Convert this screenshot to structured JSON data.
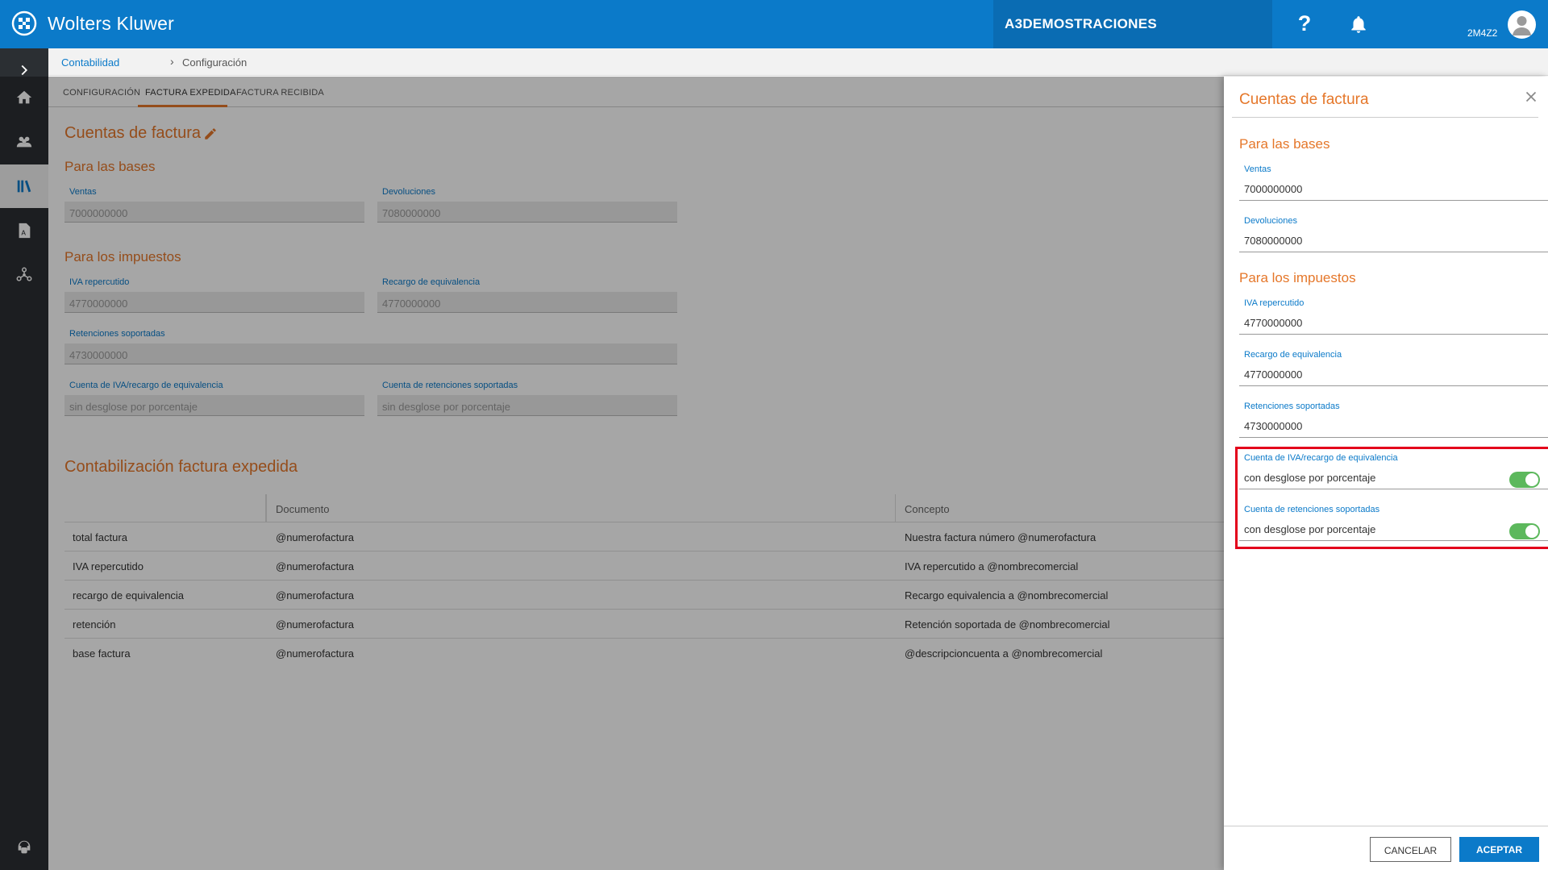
{
  "topbar": {
    "brand": "Wolters Kluwer",
    "organization": "A3DEMOSTRACIONES",
    "help_icon": "?",
    "user": "2M4Z2"
  },
  "breadcrumb": {
    "parent": "Contabilidad",
    "separator": "›",
    "current": "Configuración"
  },
  "tabs": [
    {
      "label": "CONFIGURACIÓN"
    },
    {
      "label": "FACTURA EXPEDIDA"
    },
    {
      "label": "FACTURA RECIBIDA"
    }
  ],
  "main": {
    "title": "Cuentas de factura",
    "bases_title": "Para las bases",
    "impuestos_title": "Para los impuestos",
    "fields": {
      "ventas": {
        "label": "Ventas",
        "value": "7000000000"
      },
      "devoluciones": {
        "label": "Devoluciones",
        "value": "7080000000"
      },
      "iva_repercutido": {
        "label": "IVA repercutido",
        "value": "4770000000"
      },
      "recargo": {
        "label": "Recargo de equivalencia",
        "value": "4770000000"
      },
      "retenciones": {
        "label": "Retenciones soportadas",
        "value": "4730000000"
      },
      "cuenta_iva": {
        "label": "Cuenta de IVA/recargo de equivalencia",
        "value": "sin desglose por porcentaje"
      },
      "cuenta_ret": {
        "label": "Cuenta de retenciones soportadas",
        "value": "sin desglose por porcentaje"
      }
    },
    "contab_title": "Contabilización factura expedida",
    "table": {
      "headers": [
        "",
        "Documento",
        "Concepto"
      ],
      "rows": [
        [
          "total factura",
          "@numerofactura",
          "Nuestra factura número @numerofactura"
        ],
        [
          "IVA repercutido",
          "@numerofactura",
          "IVA repercutido a @nombrecomercial"
        ],
        [
          "recargo de equivalencia",
          "@numerofactura",
          "Recargo equivalencia a @nombrecomercial"
        ],
        [
          "retención",
          "@numerofactura",
          "Retención soportada de @nombrecomercial"
        ],
        [
          "base factura",
          "@numerofactura",
          "@descripcioncuenta a @nombrecomercial"
        ]
      ]
    }
  },
  "panel": {
    "title": "Cuentas de factura",
    "bases_title": "Para las bases",
    "impuestos_title": "Para los impuestos",
    "ventas": {
      "label": "Ventas",
      "value": "7000000000"
    },
    "devoluciones": {
      "label": "Devoluciones",
      "value": "7080000000"
    },
    "iva_repercutido": {
      "label": "IVA repercutido",
      "value": "4770000000"
    },
    "recargo": {
      "label": "Recargo de equivalencia",
      "value": "4770000000"
    },
    "retenciones": {
      "label": "Retenciones soportadas",
      "value": "4730000000"
    },
    "cuenta_iva": {
      "label": "Cuenta de IVA/recargo de equivalencia",
      "value": "con desglose por porcentaje",
      "toggle_on": true
    },
    "cuenta_ret": {
      "label": "Cuenta de retenciones soportadas",
      "value": "con desglose por porcentaje",
      "toggle_on": true
    },
    "cancel_label": "CANCELAR",
    "accept_label": "ACEPTAR"
  },
  "colors": {
    "brand_blue": "#0b7ac9",
    "accent_orange": "#e5772a",
    "toggle_green": "#5cb85c",
    "highlight_red": "#e3001b"
  },
  "icons": {
    "logo": "wolters-kluwer-logo",
    "help": "help-icon",
    "bell": "bell-icon",
    "avatar": "user-avatar-icon",
    "sidebar": [
      "chevron-right-icon",
      "home-icon",
      "users-icon",
      "library-icon",
      "document-icon",
      "network-icon",
      "support-icon"
    ],
    "edit": "pencil-icon",
    "close": "close-icon"
  }
}
